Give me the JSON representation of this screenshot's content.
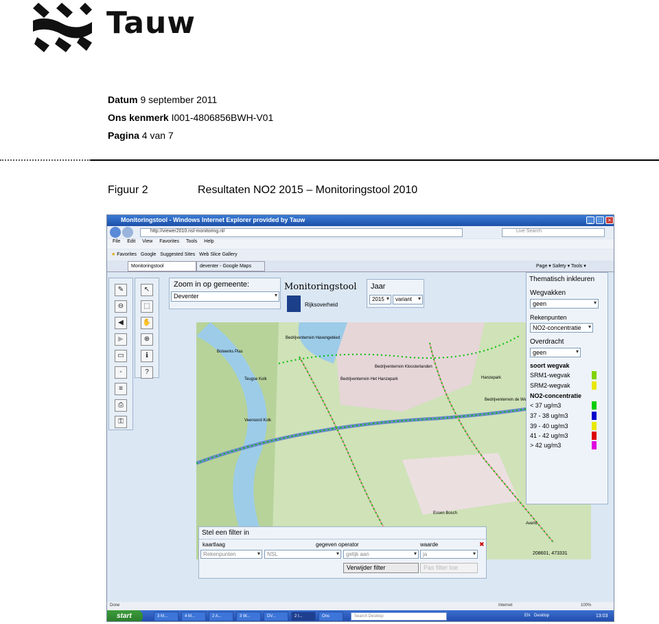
{
  "header": {
    "brand": "Tauw",
    "datum_label": "Datum",
    "datum_value": "9 september 2011",
    "kenmerk_label": "Ons kenmerk",
    "kenmerk_value": "I001-4806856BWH-V01",
    "pagina_label": "Pagina",
    "pagina_value": "4 van 7"
  },
  "figure": {
    "label": "Figuur 2",
    "title": "Resultaten NO2 2015 – Monitoringstool 2010"
  },
  "browser": {
    "title": "Monitoringstool - Windows Internet Explorer provided by Tauw",
    "url": "http://viewer2010.nsl-monitoring.nl/",
    "search_placeholder": "Live Search",
    "menu": [
      "File",
      "Edit",
      "View",
      "Favorites",
      "Tools",
      "Help"
    ],
    "favorites": [
      "Favorites",
      "Google",
      "Suggested Sites",
      "Web Slice Gallery"
    ],
    "tabs": [
      "Monitoringstool",
      "deventer - Google Maps"
    ],
    "commands": [
      "Page",
      "Safety",
      "Tools"
    ],
    "status_left": "Done",
    "status_zone": "Internet",
    "zoom": "100%"
  },
  "app": {
    "zoom_label": "Zoom in op gemeente:",
    "zoom_value": "Deventer",
    "logo_title": "Monitoringstool",
    "logo_sub": "Rijksoverheid",
    "jaar_label": "Jaar",
    "jaar_value": "2015",
    "variant_value": "variant",
    "coords": "208601, 473331"
  },
  "legend": {
    "title": "Thematisch inkleuren",
    "wegvakken_label": "Wegvakken",
    "wegvakken_value": "geen",
    "rekenpunten_label": "Rekenpunten",
    "rekenpunten_value": "NO2-concentratie",
    "overdracht_label": "Overdracht",
    "overdracht_value": "geen",
    "soort_label": "soort wegvak",
    "soort_items": [
      {
        "label": "SRM1-wegvak",
        "color": "#7fd400"
      },
      {
        "label": "SRM2-wegvak",
        "color": "#e8e800"
      }
    ],
    "conc_label": "NO2-concentratie",
    "conc_items": [
      {
        "label": "< 37 ug/m3",
        "color": "#00cc00"
      },
      {
        "label": "37 - 38 ug/m3",
        "color": "#0000cc"
      },
      {
        "label": "39 - 40 ug/m3",
        "color": "#e8e800"
      },
      {
        "label": "41 - 42 ug/m3",
        "color": "#dd0000"
      },
      {
        "label": "> 42 ug/m3",
        "color": "#e000e0"
      }
    ]
  },
  "filter": {
    "title": "Stel een filter in",
    "col_kaartlaag": "kaartlaag",
    "col_operator": "gegeven operator",
    "col_waarde": "waarde",
    "kaartlaag_value": "Rekenpunten",
    "gegeven_value": "NSL",
    "operator_value": "gelijk aan",
    "waarde_value": "ja",
    "btn_remove": "Verwijder filter",
    "btn_add": "Pas filter toe"
  },
  "map_labels": [
    "Bolwerks Plas",
    "Teugse Kolk",
    "Veenoord Kolk",
    "Bedrijventerrein Havengebied",
    "Bedrijventerrein Het Hanzepark",
    "Bedrijventerrein Kloosterlanden",
    "Hanzepark",
    "Bedrijventerrein de Weteringen",
    "Essen Bosch",
    "Averlo"
  ],
  "taskbar": {
    "start": "start",
    "items": [
      "3 M...",
      "4 M...",
      "2 A...",
      "3 W...",
      "DV...",
      "2 I...",
      "Ons"
    ],
    "search": "Search Desktop",
    "lang": "EN",
    "desktop": "Desktop",
    "clock": "13:03"
  }
}
